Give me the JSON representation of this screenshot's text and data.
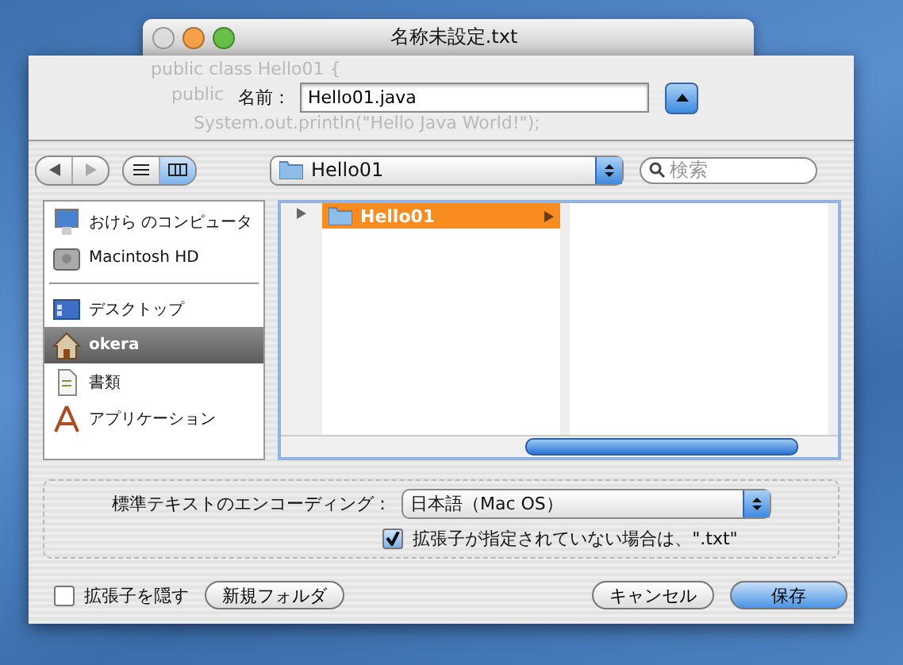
{
  "window": {
    "title": "名称未設定.txt",
    "background_code": [
      "public class Hello01 {",
      "public",
      "System.out.println(\"Hello Java World!\");"
    ]
  },
  "name_field": {
    "label": "名前：",
    "value": "Hello01.java",
    "expanded": true
  },
  "view_modes": [
    {
      "kind": "list",
      "selected": false
    },
    {
      "kind": "columns",
      "selected": true
    }
  ],
  "location": {
    "value": "Hello01"
  },
  "search": {
    "placeholder": "検索"
  },
  "sidebar": {
    "devices": [
      {
        "kind": "computer",
        "label": "おけら のコンピュータ",
        "selected": false
      },
      {
        "kind": "disk",
        "label": "Macintosh HD",
        "selected": false
      }
    ],
    "places": [
      {
        "kind": "desktop",
        "label": "デスクトップ",
        "selected": false
      },
      {
        "kind": "home",
        "label": "okera",
        "selected": true
      },
      {
        "kind": "documents",
        "label": "書類",
        "selected": false
      },
      {
        "kind": "applications",
        "label": "アプリケーション",
        "selected": false
      }
    ]
  },
  "browser": {
    "columns": [
      {
        "items": [
          {
            "label": "Hello01",
            "selected": true
          }
        ]
      },
      {}
    ]
  },
  "encoding": {
    "label": "標準テキストのエンコーディング：",
    "value": "日本語（Mac OS）"
  },
  "append_extension": {
    "label": "拡張子が指定されていない場合は、\".txt\"",
    "checked": true
  },
  "hide_extension": {
    "label": "拡張子を隠す",
    "checked": false
  },
  "buttons": [
    {
      "label": "新規フォルダ",
      "kind": "normal"
    },
    {
      "label": "キャンセル",
      "kind": "normal"
    },
    {
      "label": "保存",
      "kind": "default"
    }
  ]
}
